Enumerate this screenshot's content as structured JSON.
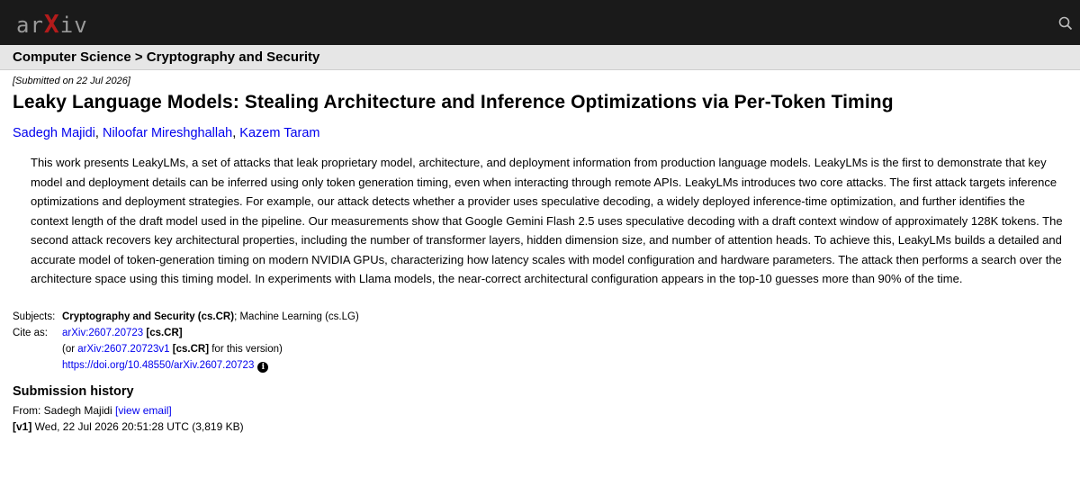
{
  "header": {
    "logo_a": "ar",
    "logo_x": "X",
    "logo_b": "iv",
    "search_icon": "search-icon"
  },
  "breadcrumb": {
    "text": "Computer Science > Cryptography and Security"
  },
  "paper": {
    "submitted": "[Submitted on 22 Jul 2026]",
    "title": "Leaky Language Models: Stealing Architecture and Inference Optimizations via Per-Token Timing",
    "authors": [
      "Sadegh Majidi",
      "Niloofar Mireshghallah",
      "Kazem Taram"
    ],
    "abstract": "This work presents LeakyLMs, a set of attacks that leak proprietary model, architecture, and deployment information from production language models. LeakyLMs is the first to demonstrate that key model and deployment details can be inferred using only token generation timing, even when interacting through remote APIs. LeakyLMs introduces two core attacks. The first attack targets inference optimizations and deployment strategies. For example, our attack detects whether a provider uses speculative decoding, a widely deployed inference-time optimization, and further identifies the context length of the draft model used in the pipeline. Our measurements show that Google Gemini Flash 2.5 uses speculative decoding with a draft context window of approximately 128K tokens. The second attack recovers key architectural properties, including the number of transformer layers, hidden dimension size, and number of attention heads. To achieve this, LeakyLMs builds a detailed and accurate model of token-generation timing on modern NVIDIA GPUs, characterizing how latency scales with model configuration and hardware parameters. The attack then performs a search over the architecture space using this timing model. In experiments with Llama models, the near-correct architectural configuration appears in the top-10 guesses more than 90% of the time."
  },
  "meta": {
    "subjects_label": "Subjects:",
    "subjects_primary": "Cryptography and Security (cs.CR)",
    "subjects_rest": "; Machine Learning (cs.LG)",
    "cite_label": "Cite as:",
    "cite_id": "arXiv:2607.20723",
    "cite_tag": "[cs.CR]",
    "version_pre": "(or ",
    "version_id": "arXiv:2607.20723v1",
    "version_tag": "[cs.CR]",
    "version_post": " for this version)",
    "doi": "https://doi.org/10.48550/arXiv.2607.20723",
    "info_glyph": "i"
  },
  "history": {
    "title": "Submission history",
    "from_pre": "From: Sadegh Majidi ",
    "view_email": "[view email]",
    "v1_label": "[v1]",
    "v1_text": " Wed, 22 Jul 2026 20:51:28 UTC (3,819 KB)"
  },
  "colors": {
    "topbar": "#1a1a1a",
    "logo_accent": "#b31b1b",
    "link": "#0000ee",
    "crumbbar": "#e6e6e6"
  }
}
